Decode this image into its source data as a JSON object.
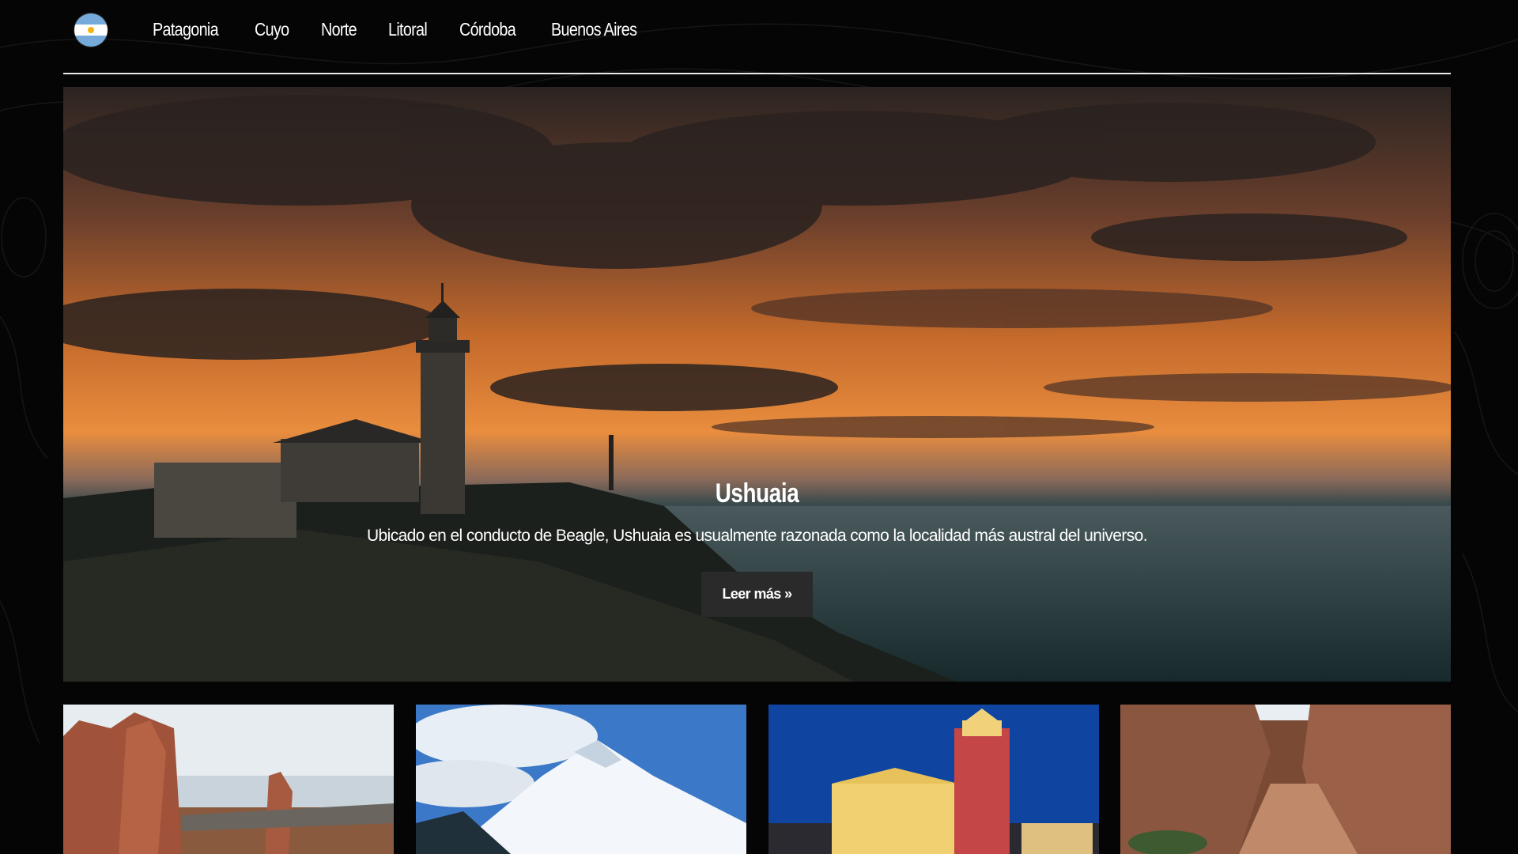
{
  "nav": {
    "flag_icon": "argentina-flag-icon",
    "links": [
      "Patagonia",
      "Cuyo",
      "Norte",
      "Litoral",
      "Córdoba",
      "Buenos Aires"
    ]
  },
  "hero": {
    "title": "Ushuaia",
    "description": "Ubicado en el conducto de Beagle, Ushuaia es usualmente razonada como la localidad más austral del universo.",
    "button_label": "Leer más »",
    "image": "lighthouse-sunset-coast"
  },
  "cards": [
    {
      "image": "red-rock-formations"
    },
    {
      "image": "snowy-volcano"
    },
    {
      "image": "illuminated-church-salta"
    },
    {
      "image": "red-canyon"
    }
  ],
  "colors": {
    "background": "#050505",
    "nav_rule": "#e9e9e9",
    "button_bg": "#2a2a2a"
  }
}
